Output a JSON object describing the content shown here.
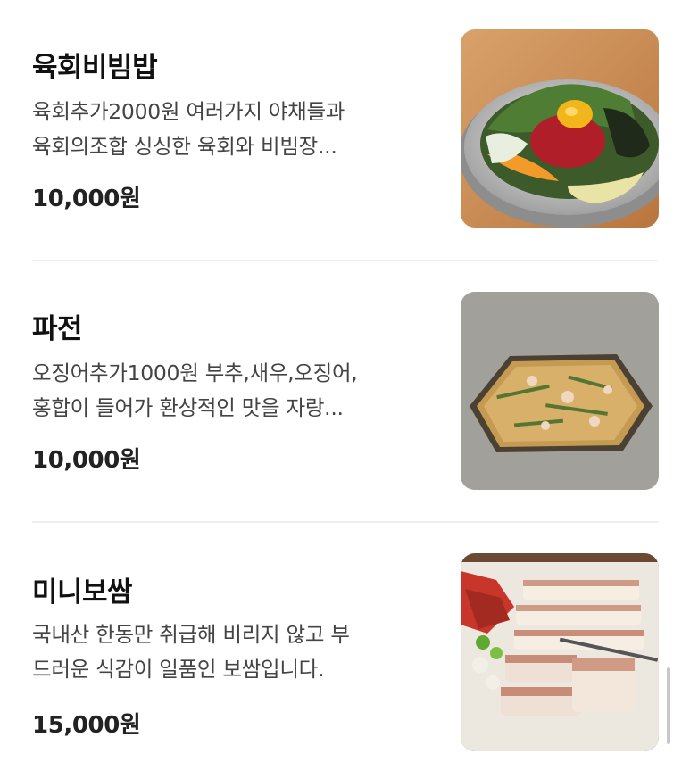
{
  "menu": {
    "items": [
      {
        "name": "육회비빔밥",
        "desc_line1": "육회추가2000원 여러가지 야채들과",
        "desc_line2": "육회의조합 싱싱한 육회와 비빔장...",
        "price": "10,000원",
        "image_icon": "bibimbap-photo"
      },
      {
        "name": "파전",
        "desc_line1": "오징어추가1000원 부추,새우,오징어,",
        "desc_line2": "홍합이 들어가 환상적인 맛을 자랑...",
        "price": "10,000원",
        "image_icon": "pajeon-photo"
      },
      {
        "name": "미니보쌈",
        "desc_line1": "국내산 한동만 취급해 비리지 않고 부",
        "desc_line2": "드러운 식감이 일품인 보쌈입니다.",
        "price": "15,000원",
        "image_icon": "bossam-photo"
      }
    ]
  }
}
